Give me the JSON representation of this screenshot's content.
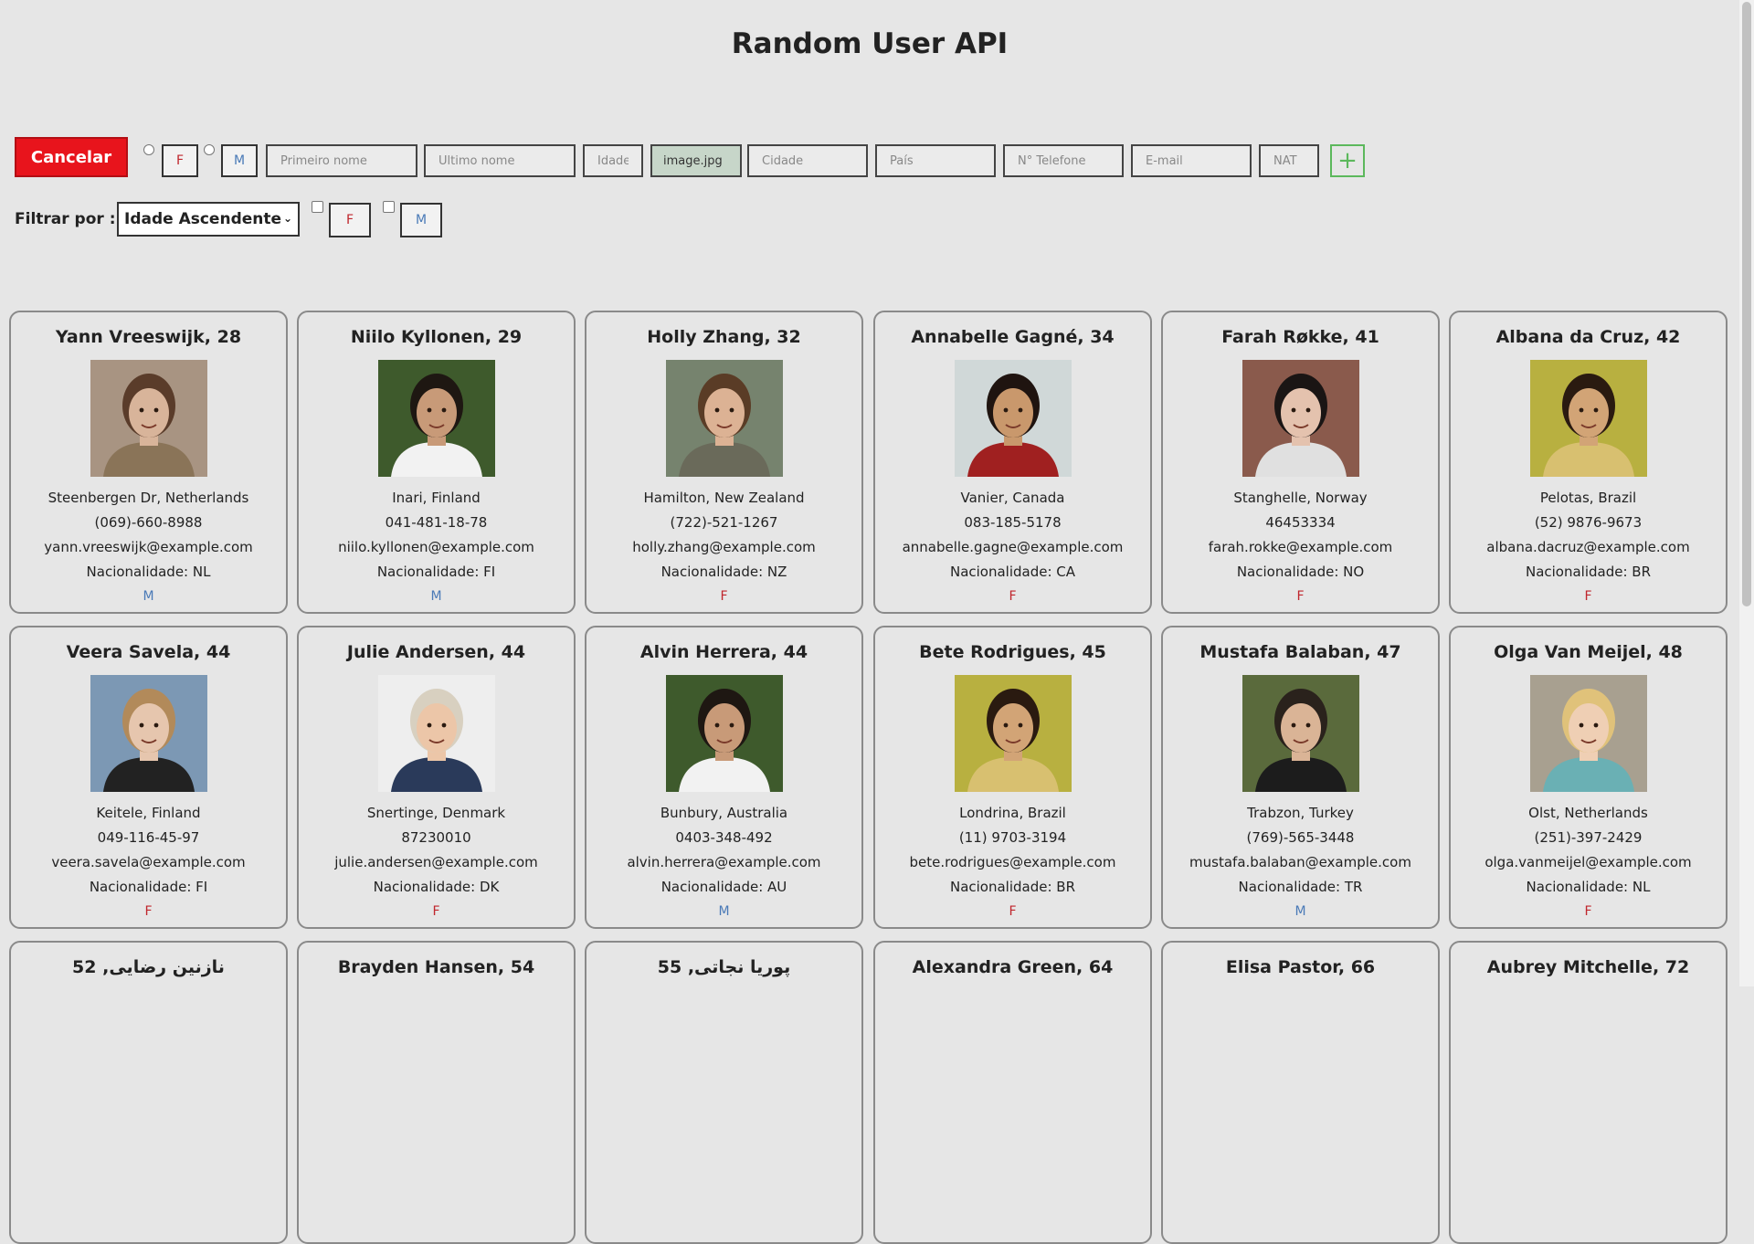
{
  "title": "Random User API",
  "toolbar": {
    "cancel_label": "Cancelar",
    "gender_f": "F",
    "gender_m": "M",
    "first_name_placeholder": "Primeiro nome",
    "last_name_placeholder": "Ultimo nome",
    "age_placeholder": "Idade",
    "file_label": "image.jpg",
    "city_placeholder": "Cidade",
    "country_placeholder": "País",
    "phone_placeholder": "N° Telefone",
    "email_placeholder": "E-mail",
    "nat_placeholder": "NAT",
    "add_label": "+"
  },
  "filter": {
    "label": "Filtrar por :",
    "selected": "Idade Ascendente",
    "gender_f": "F",
    "gender_m": "M"
  },
  "users": [
    {
      "name": "Yann Vreeswijk, 28",
      "city": "Steenbergen Dr, Netherlands",
      "phone": "(069)-660-8988",
      "email": "yann.vreeswijk@example.com",
      "nat": "Nacionalidade: NL",
      "gender": "M",
      "photo": "photo-man-1"
    },
    {
      "name": "Niilo Kyllonen, 29",
      "city": "Inari, Finland",
      "phone": "041-481-18-78",
      "email": "niilo.kyllonen@example.com",
      "nat": "Nacionalidade: FI",
      "gender": "M",
      "photo": "photo-man-2"
    },
    {
      "name": "Holly Zhang, 32",
      "city": "Hamilton, New Zealand",
      "phone": "(722)-521-1267",
      "email": "holly.zhang@example.com",
      "nat": "Nacionalidade: NZ",
      "gender": "F",
      "photo": "photo-woman-1"
    },
    {
      "name": "Annabelle Gagné, 34",
      "city": "Vanier, Canada",
      "phone": "083-185-5178",
      "email": "annabelle.gagne@example.com",
      "nat": "Nacionalidade: CA",
      "gender": "F",
      "photo": "photo-woman-2"
    },
    {
      "name": "Farah Røkke, 41",
      "city": "Stanghelle, Norway",
      "phone": "46453334",
      "email": "farah.rokke@example.com",
      "nat": "Nacionalidade: NO",
      "gender": "F",
      "photo": "photo-woman-3"
    },
    {
      "name": "Albana da Cruz, 42",
      "city": "Pelotas, Brazil",
      "phone": "(52) 9876-9673",
      "email": "albana.dacruz@example.com",
      "nat": "Nacionalidade: BR",
      "gender": "F",
      "photo": "photo-woman-4"
    },
    {
      "name": "Veera Savela, 44",
      "city": "Keitele, Finland",
      "phone": "049-116-45-97",
      "email": "veera.savela@example.com",
      "nat": "Nacionalidade: FI",
      "gender": "F",
      "photo": "photo-woman-5"
    },
    {
      "name": "Julie Andersen, 44",
      "city": "Snertinge, Denmark",
      "phone": "87230010",
      "email": "julie.andersen@example.com",
      "nat": "Nacionalidade: DK",
      "gender": "F",
      "photo": "photo-woman-6"
    },
    {
      "name": "Alvin Herrera, 44",
      "city": "Bunbury, Australia",
      "phone": "0403-348-492",
      "email": "alvin.herrera@example.com",
      "nat": "Nacionalidade: AU",
      "gender": "M",
      "photo": "photo-man-3"
    },
    {
      "name": "Bete Rodrigues, 45",
      "city": "Londrina, Brazil",
      "phone": "(11) 9703-3194",
      "email": "bete.rodrigues@example.com",
      "nat": "Nacionalidade: BR",
      "gender": "F",
      "photo": "photo-woman-7"
    },
    {
      "name": "Mustafa Balaban, 47",
      "city": "Trabzon, Turkey",
      "phone": "(769)-565-3448",
      "email": "mustafa.balaban@example.com",
      "nat": "Nacionalidade: TR",
      "gender": "M",
      "photo": "photo-man-4"
    },
    {
      "name": "Olga Van Meijel, 48",
      "city": "Olst, Netherlands",
      "phone": "(251)-397-2429",
      "email": "olga.vanmeijel@example.com",
      "nat": "Nacionalidade: NL",
      "gender": "F",
      "photo": "photo-woman-8"
    },
    {
      "name": "نازنین رضایی, 52"
    },
    {
      "name": "Brayden Hansen, 54"
    },
    {
      "name": "پوریا نجاتی, 55"
    },
    {
      "name": "Alexandra Green, 64"
    },
    {
      "name": "Elisa Pastor, 66"
    },
    {
      "name": "Aubrey Mitchelle, 72"
    }
  ],
  "colors": {
    "background": "#e6e6e6",
    "cancel": "#e8141c",
    "female": "#c0262d",
    "male": "#4a7ab7",
    "add": "#5cb85c",
    "file": "#c7d6c9"
  }
}
